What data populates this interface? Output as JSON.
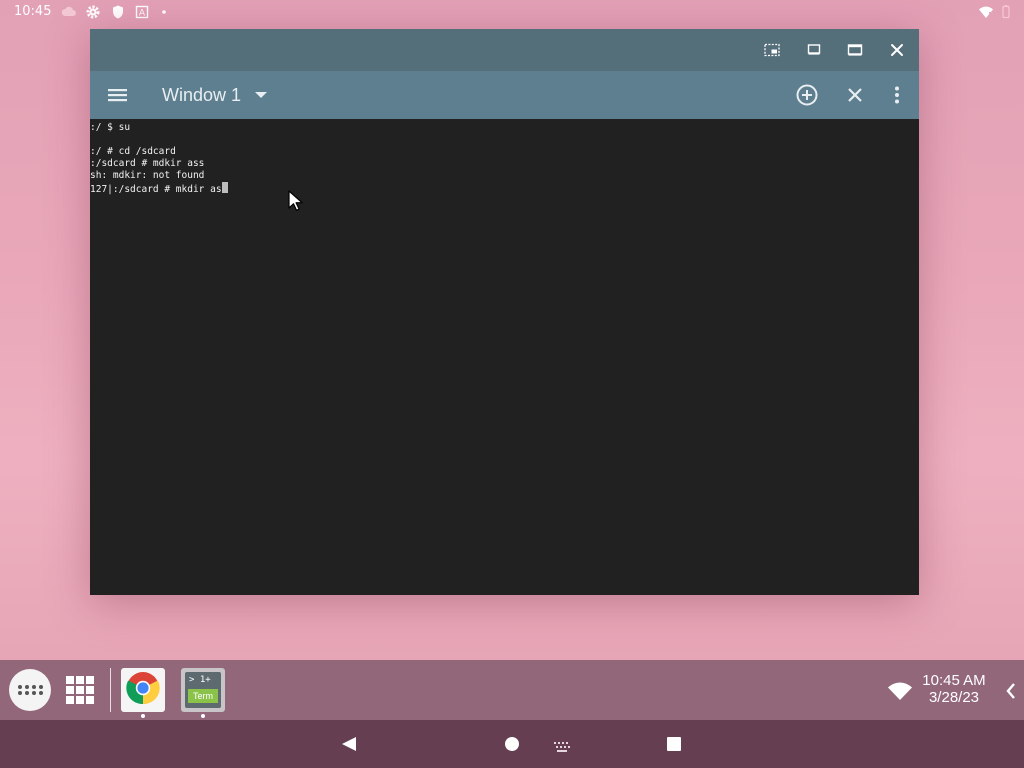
{
  "status_bar": {
    "time": "10:45",
    "icons": [
      "cloud-icon",
      "gear-icon",
      "shield-icon",
      "a-notification-icon",
      "dot-icon",
      "wifi-icon",
      "battery-icon"
    ]
  },
  "window": {
    "caption_buttons": [
      "pip-icon",
      "restore-icon",
      "maximize-icon",
      "close-icon"
    ],
    "title": "Window 1",
    "actions": [
      "add-window-icon",
      "close-window-icon",
      "overflow-menu-icon"
    ]
  },
  "terminal": {
    "lines": [
      ":/ $ su",
      "",
      ":/ # cd /sdcard",
      ":/sdcard # mdkir ass",
      "sh: mdkir: not found",
      "127|:/sdcard # mkdir as"
    ]
  },
  "taskbar": {
    "apps": [
      {
        "name": "chrome",
        "icon": "chrome-icon"
      },
      {
        "name": "terminal",
        "icon": "term-icon",
        "line1": "> 1+",
        "line2": "Term"
      }
    ],
    "clock_time": "10:45 AM",
    "clock_date": "3/28/23"
  },
  "colors": {
    "caption": "#546e7a",
    "appbar": "#5e7f8f",
    "terminal_bg": "#212121",
    "taskbar": "#93677a",
    "navbar": "#653e52"
  }
}
